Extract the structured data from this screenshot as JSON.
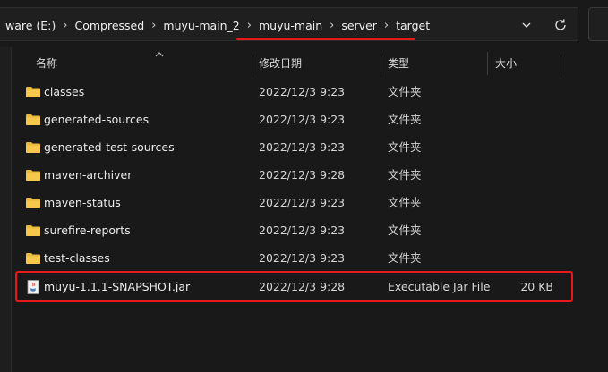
{
  "breadcrumb": {
    "items": [
      {
        "label": "ware (E:)"
      },
      {
        "label": "Compressed"
      },
      {
        "label": "muyu-main_2"
      },
      {
        "label": "muyu-main"
      },
      {
        "label": "server"
      },
      {
        "label": "target"
      }
    ],
    "separator": "›"
  },
  "columns": {
    "name": "名称",
    "date": "修改日期",
    "type": "类型",
    "size": "大小"
  },
  "files": [
    {
      "name": "classes",
      "date": "2022/12/3 9:23",
      "type": "文件夹",
      "size": "",
      "icon": "folder-icon"
    },
    {
      "name": "generated-sources",
      "date": "2022/12/3 9:23",
      "type": "文件夹",
      "size": "",
      "icon": "folder-icon"
    },
    {
      "name": "generated-test-sources",
      "date": "2022/12/3 9:23",
      "type": "文件夹",
      "size": "",
      "icon": "folder-icon"
    },
    {
      "name": "maven-archiver",
      "date": "2022/12/3 9:28",
      "type": "文件夹",
      "size": "",
      "icon": "folder-icon"
    },
    {
      "name": "maven-status",
      "date": "2022/12/3 9:23",
      "type": "文件夹",
      "size": "",
      "icon": "folder-icon"
    },
    {
      "name": "surefire-reports",
      "date": "2022/12/3 9:23",
      "type": "文件夹",
      "size": "",
      "icon": "folder-icon"
    },
    {
      "name": "test-classes",
      "date": "2022/12/3 9:23",
      "type": "文件夹",
      "size": "",
      "icon": "folder-icon"
    },
    {
      "name": "muyu-1.1.1-SNAPSHOT.jar",
      "date": "2022/12/3 9:28",
      "type": "Executable Jar File",
      "size": "20 KB",
      "icon": "jar-file-icon"
    }
  ],
  "colors": {
    "annotation": "#e8191a",
    "folder": "#e8b93a",
    "background": "#191919"
  }
}
